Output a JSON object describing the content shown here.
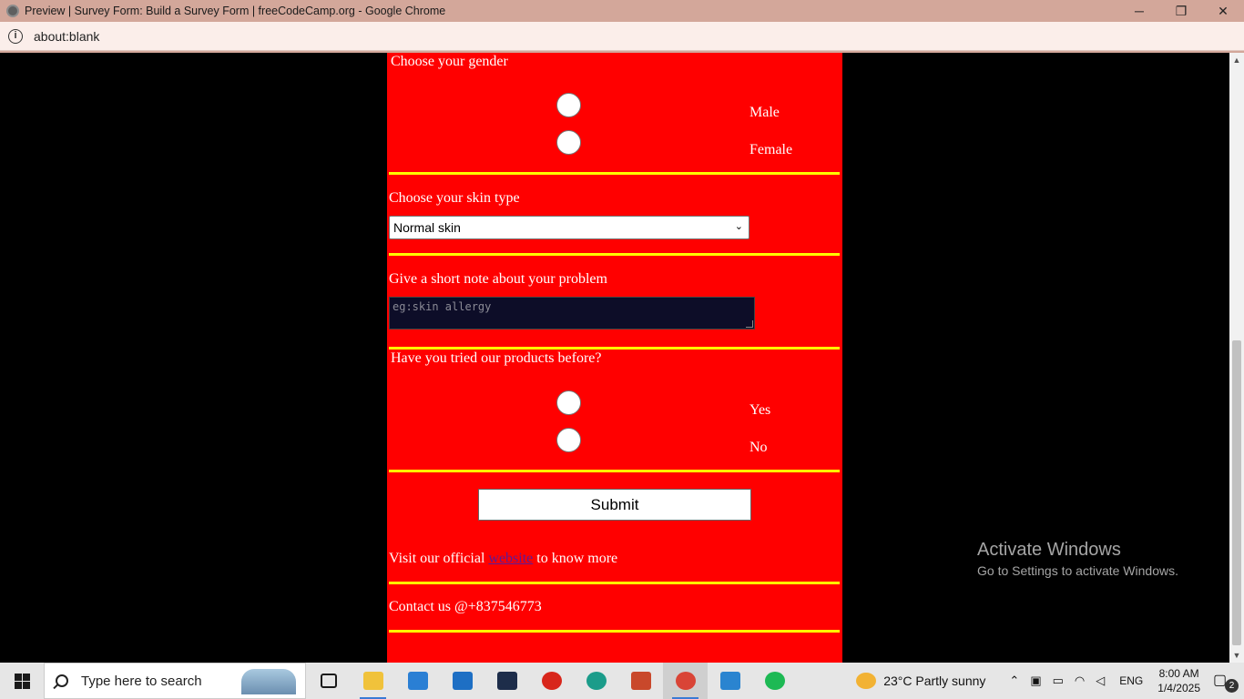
{
  "window": {
    "title": "Preview | Survey Form: Build a Survey Form | freeCodeCamp.org - Google Chrome",
    "minimize": "─",
    "restore": "❐",
    "close": "✕"
  },
  "address_bar": {
    "url": "about:blank",
    "info_glyph": "i"
  },
  "form": {
    "gender": {
      "label": "Choose your gender",
      "options": [
        "Male",
        "Female"
      ]
    },
    "skin": {
      "label": "Choose your skin type",
      "selected": "Normal skin",
      "chevron": "⌄"
    },
    "note": {
      "label": "Give a short note about your problem",
      "placeholder": "eg:skin allergy"
    },
    "tried": {
      "label": "Have you tried our products before?",
      "options": [
        "Yes",
        "No"
      ]
    },
    "submit_label": "Submit",
    "visit": {
      "prefix": "Visit our official ",
      "link_text": "website",
      "suffix": " to know more"
    },
    "contact": "Contact us @+837546773"
  },
  "scrollbar": {
    "up": "▲",
    "down": "▼"
  },
  "watermark": {
    "line1": "Activate Windows",
    "line2": "Go to Settings to activate Windows."
  },
  "taskbar": {
    "search_placeholder": "Type here to search",
    "apps": [
      {
        "name": "task-view",
        "color": "#1a1a1a"
      },
      {
        "name": "file-explorer",
        "color": "#f0c23b"
      },
      {
        "name": "microsoft-store",
        "color": "#2a7fd4"
      },
      {
        "name": "mail",
        "color": "#1e6fc4"
      },
      {
        "name": "terminal-app",
        "color": "#1d2d4a"
      },
      {
        "name": "record-app",
        "color": "#d8261b"
      },
      {
        "name": "edge",
        "color": "#1b9c8a"
      },
      {
        "name": "powerpoint",
        "color": "#c9482b"
      },
      {
        "name": "chrome",
        "color": "#d94436"
      },
      {
        "name": "vscode",
        "color": "#2a84d0"
      },
      {
        "name": "spotify",
        "color": "#1db954"
      }
    ],
    "weather": "23°C  Partly sunny",
    "language": "ENG",
    "time": "8:00 AM",
    "date": "1/4/2025",
    "notifications": "2"
  }
}
